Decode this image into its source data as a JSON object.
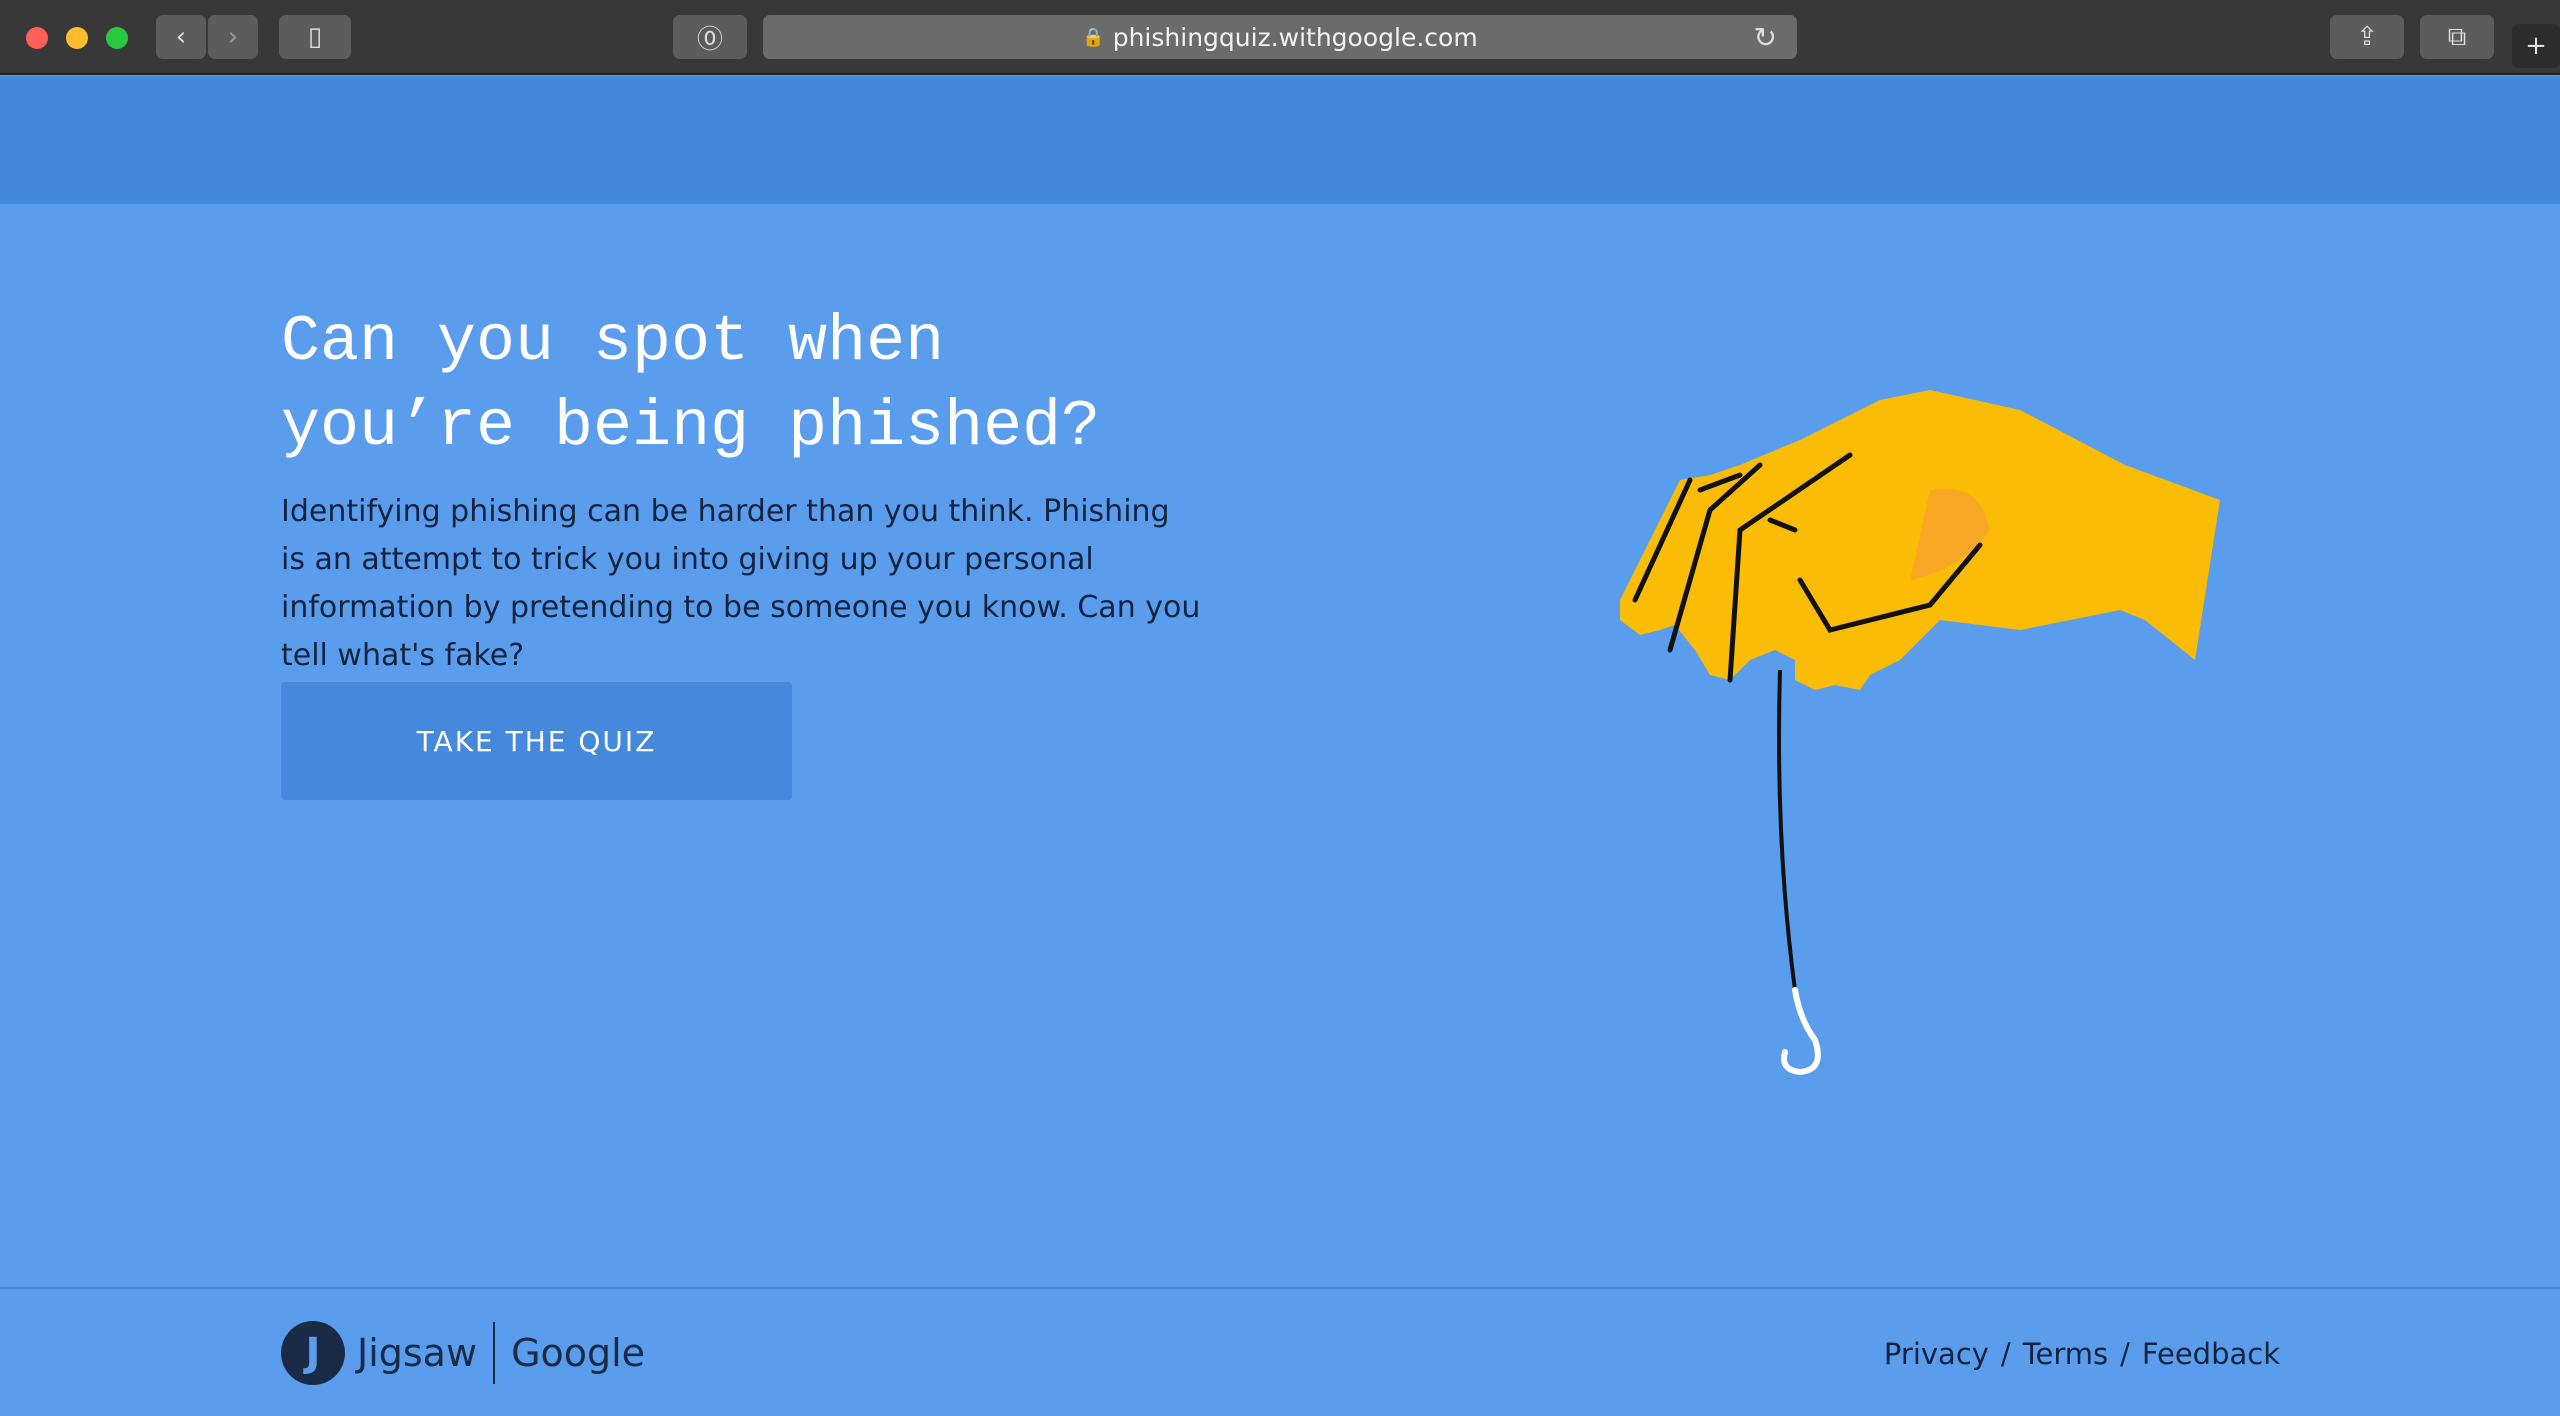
{
  "browser": {
    "url": "phishingquiz.withgoogle.com"
  },
  "hero": {
    "title_line1": "Can you spot when",
    "title_line2": "you’re being phished?",
    "description": "Identifying phishing can be harder than you think. Phishing is an attempt to trick you into giving up your personal information by pretending to be someone you know. Can you tell what's fake?",
    "cta_label": "TAKE THE QUIZ"
  },
  "footer": {
    "brand1": "Jigsaw",
    "brand2": "Google",
    "links": [
      "Privacy",
      "Terms",
      "Feedback"
    ],
    "separator": "/"
  },
  "colors": {
    "header_band": "#428ad9",
    "background": "#5a9dec",
    "button": "#4489dc",
    "hand": "#fbbc05"
  }
}
